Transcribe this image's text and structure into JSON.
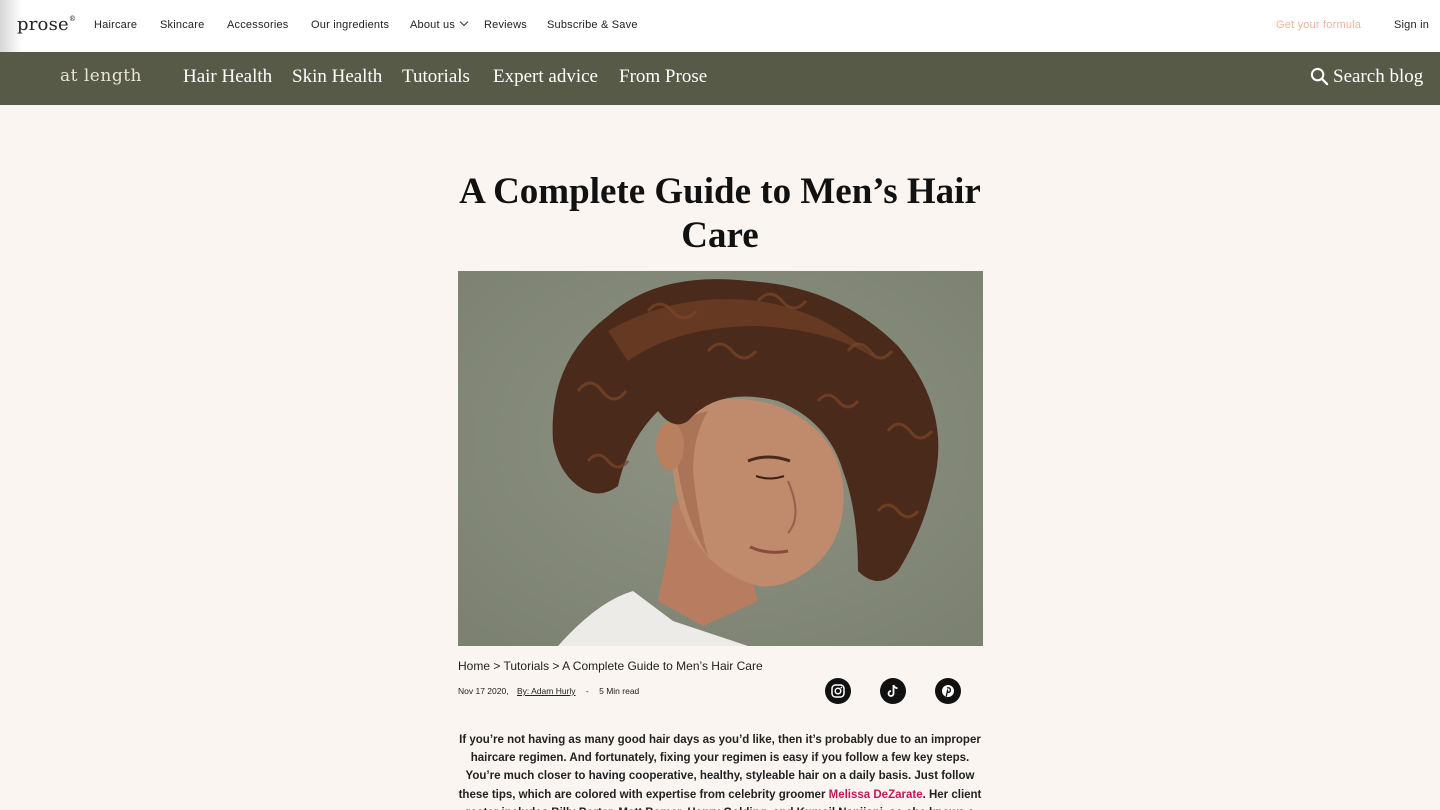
{
  "topbar": {
    "logo": "prose",
    "logo_mark": "®",
    "nav": [
      "Haircare",
      "Skincare",
      "Accessories",
      "Our ingredients",
      "About us",
      "Reviews",
      "Subscribe & Save"
    ],
    "cta": "Get your formula",
    "signin": "Sign in"
  },
  "blogbar": {
    "logo": "at length",
    "nav": [
      "Hair Health",
      "Skin Health",
      "Tutorials",
      "Expert advice",
      "From Prose"
    ],
    "search": "Search blog"
  },
  "article": {
    "title": "A Complete Guide to Men’s Hair Care",
    "breadcrumb": {
      "home": "Home",
      "sep": ">",
      "category": "Tutorials",
      "current": "A Complete Guide to Men’s Hair Care"
    },
    "date": "Nov 17 2020,",
    "author": "By: Adam Hurly",
    "meta_sep": "-",
    "read_time": "5 Min read",
    "social": [
      "instagram-icon",
      "tiktok-icon",
      "pinterest-icon"
    ],
    "body_before_link": "If you’re not having as many good hair days as you’d like, then it’s probably due to an improper haircare regimen. And fortunately, fixing your regimen is easy if you follow a few key steps. You’re much closer to having cooperative, healthy, styleable hair on a daily basis. Just follow these tips, which are colored with expertise from celebrity groomer ",
    "body_link": "Melissa DeZarate",
    "body_after_link": ". Her client roster includes Billy Porter, Matt Bomer, Henry Golding, and Kumail Nanjiani, so she knows a few things about"
  },
  "colors": {
    "blogbar_bg": "#575a47",
    "page_bg": "#faf5f0",
    "cta": "#f0b39a",
    "link": "#c2185b"
  }
}
